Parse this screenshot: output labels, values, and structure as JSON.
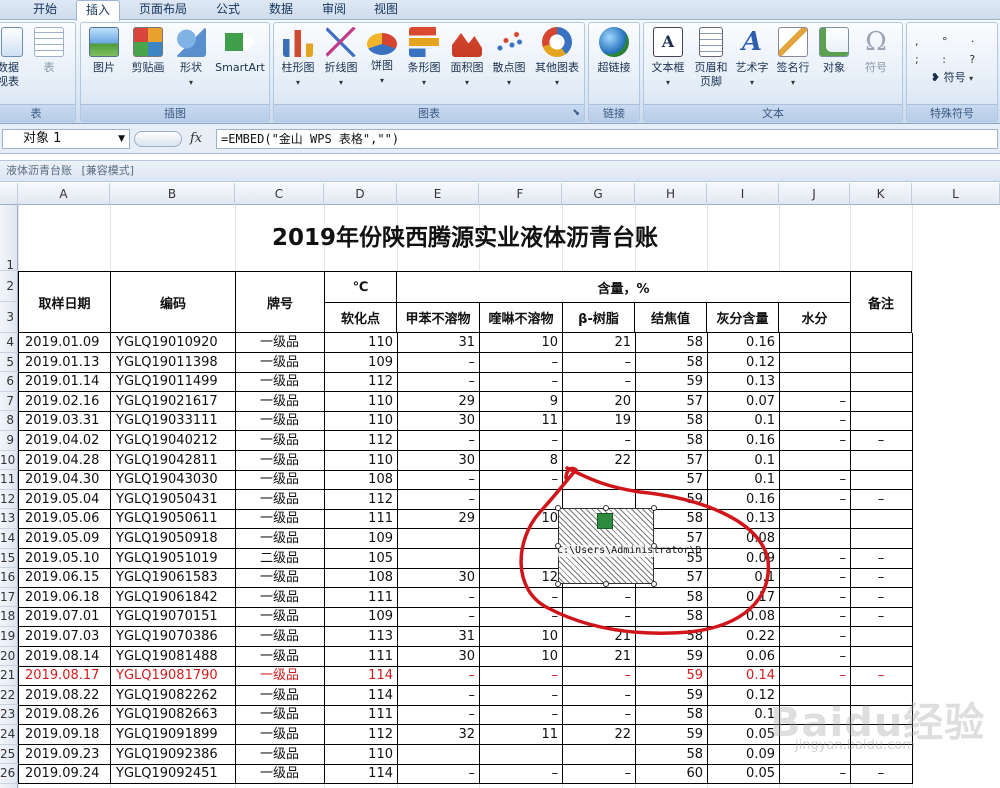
{
  "tabs": [
    "开始",
    "插入",
    "页面布局",
    "公式",
    "数据",
    "审阅",
    "视图"
  ],
  "active_tab": "插入",
  "ribbon": {
    "groups": [
      {
        "label": "表",
        "buttons": [
          {
            "label": "数据\n视表",
            "icon": "pivot-table-icon"
          },
          {
            "label": "表",
            "icon": "table-icon"
          }
        ]
      },
      {
        "label": "插图",
        "buttons": [
          {
            "label": "图片",
            "icon": "picture-icon"
          },
          {
            "label": "剪贴画",
            "icon": "clipart-icon"
          },
          {
            "label": "形状",
            "icon": "shapes-icon"
          },
          {
            "label": "SmartArt",
            "icon": "smartart-icon"
          }
        ]
      },
      {
        "label": "图表",
        "buttons": [
          {
            "label": "柱形图",
            "icon": "column-chart-icon"
          },
          {
            "label": "折线图",
            "icon": "line-chart-icon"
          },
          {
            "label": "饼图",
            "icon": "pie-chart-icon"
          },
          {
            "label": "条形图",
            "icon": "bar-chart-icon"
          },
          {
            "label": "面积图",
            "icon": "area-chart-icon"
          },
          {
            "label": "散点图",
            "icon": "scatter-chart-icon"
          },
          {
            "label": "其他图表",
            "icon": "other-charts-icon"
          }
        ]
      },
      {
        "label": "链接",
        "buttons": [
          {
            "label": "超链接",
            "icon": "hyperlink-icon"
          }
        ]
      },
      {
        "label": "文本",
        "buttons": [
          {
            "label": "文本框",
            "icon": "textbox-icon"
          },
          {
            "label": "页眉和\n页脚",
            "icon": "header-footer-icon"
          },
          {
            "label": "艺术字",
            "icon": "wordart-icon"
          },
          {
            "label": "签名行",
            "icon": "signature-icon"
          },
          {
            "label": "对象",
            "icon": "object-icon"
          },
          {
            "label": "符号",
            "icon": "symbol-icon"
          }
        ]
      },
      {
        "label": "特殊符号",
        "buttons": [
          {
            "label": "符号",
            "icon": "special-symbol-icon"
          }
        ]
      }
    ]
  },
  "formula_bar": {
    "name_box": "对象 1",
    "fx": "fx",
    "formula": "=EMBED(\"金山 WPS 表格\",\"\")"
  },
  "workbook_title": "液体沥青台账",
  "workbook_mode": "[兼容模式]",
  "columns": [
    "A",
    "B",
    "C",
    "D",
    "E",
    "F",
    "G",
    "H",
    "I",
    "J",
    "K",
    "L"
  ],
  "row_numbers": [
    "1",
    "2",
    "3",
    "4",
    "5",
    "6",
    "7",
    "8",
    "9",
    "10",
    "11",
    "12",
    "13",
    "14",
    "15",
    "16",
    "17",
    "18",
    "19",
    "20",
    "21",
    "22",
    "23",
    "24",
    "25",
    "26"
  ],
  "sheet": {
    "title": "2019年份陕西腾源实业液体沥青台账",
    "headers": {
      "date": "取样日期",
      "code": "编码",
      "grade": "牌号",
      "unit": "℃",
      "content": "含量，%",
      "remark": "备注",
      "softening": "软化点",
      "benzene": "甲苯不溶物",
      "quinoline": "喹啉不溶物",
      "beta": "β-树脂",
      "coking": "结焦值",
      "ash": "灰分含量",
      "water": "水分"
    },
    "rows": [
      [
        "2019.01.09",
        "YGLQ19010920",
        "一级品",
        "110",
        "31",
        "10",
        "21",
        "58",
        "0.16",
        "",
        ""
      ],
      [
        "2019.01.13",
        "YGLQ19011398",
        "一级品",
        "109",
        "–",
        "–",
        "–",
        "58",
        "0.12",
        "",
        ""
      ],
      [
        "2019.01.14",
        "YGLQ19011499",
        "一级品",
        "112",
        "–",
        "–",
        "–",
        "59",
        "0.13",
        "",
        ""
      ],
      [
        "2019.02.16",
        "YGLQ19021617",
        "一级品",
        "110",
        "29",
        "9",
        "20",
        "57",
        "0.07",
        "–",
        ""
      ],
      [
        "2019.03.31",
        "YGLQ19033111",
        "一级品",
        "110",
        "30",
        "11",
        "19",
        "58",
        "0.1",
        "–",
        ""
      ],
      [
        "2019.04.02",
        "YGLQ19040212",
        "一级品",
        "112",
        "–",
        "–",
        "–",
        "58",
        "0.16",
        "–",
        "–"
      ],
      [
        "2019.04.28",
        "YGLQ19042811",
        "一级品",
        "110",
        "30",
        "8",
        "22",
        "57",
        "0.1",
        "",
        ""
      ],
      [
        "2019.04.30",
        "YGLQ19043030",
        "一级品",
        "108",
        "–",
        "–",
        "",
        "57",
        "0.1",
        "–",
        ""
      ],
      [
        "2019.05.04",
        "YGLQ19050431",
        "一级品",
        "112",
        "–",
        "",
        "",
        "59",
        "0.16",
        "–",
        "–"
      ],
      [
        "2019.05.06",
        "YGLQ19050611",
        "一级品",
        "111",
        "29",
        "10",
        "",
        "58",
        "0.13",
        "",
        ""
      ],
      [
        "2019.05.09",
        "YGLQ19050918",
        "一级品",
        "109",
        "",
        "",
        "",
        "57",
        "0.08",
        "",
        ""
      ],
      [
        "2019.05.10",
        "YGLQ19051019",
        "二级品",
        "105",
        "",
        "",
        "",
        "55",
        "0.09",
        "–",
        "–"
      ],
      [
        "2019.06.15",
        "YGLQ19061583",
        "一级品",
        "108",
        "30",
        "12",
        "",
        "57",
        "0.1",
        "–",
        "–"
      ],
      [
        "2019.06.18",
        "YGLQ19061842",
        "一级品",
        "111",
        "–",
        "–",
        "–",
        "58",
        "0.17",
        "–",
        "–"
      ],
      [
        "2019.07.01",
        "YGLQ19070151",
        "一级品",
        "109",
        "–",
        "–",
        "–",
        "58",
        "0.08",
        "–",
        "–"
      ],
      [
        "2019.07.03",
        "YGLQ19070386",
        "一级品",
        "113",
        "31",
        "10",
        "21",
        "58",
        "0.22",
        "–",
        ""
      ],
      [
        "2019.08.14",
        "YGLQ19081488",
        "一级品",
        "111",
        "30",
        "10",
        "21",
        "59",
        "0.06",
        "–",
        ""
      ],
      [
        "2019.08.17",
        "YGLQ19081790",
        "一级品",
        "114",
        "–",
        "–",
        "–",
        "59",
        "0.14",
        "–",
        "–"
      ],
      [
        "2019.08.22",
        "YGLQ19082262",
        "一级品",
        "114",
        "–",
        "–",
        "–",
        "59",
        "0.12",
        "",
        ""
      ],
      [
        "2019.08.26",
        "YGLQ19082663",
        "一级品",
        "111",
        "–",
        "–",
        "–",
        "58",
        "0.1",
        "",
        ""
      ],
      [
        "2019.09.18",
        "YGLQ19091899",
        "一级品",
        "112",
        "32",
        "11",
        "22",
        "59",
        "0.05",
        "",
        ""
      ],
      [
        "2019.09.23",
        "YGLQ19092386",
        "一级品",
        "110",
        "",
        "",
        "",
        "58",
        "0.09",
        "",
        ""
      ],
      [
        "2019.09.24",
        "YGLQ19092451",
        "一级品",
        "114",
        "–",
        "–",
        "–",
        "60",
        "0.05",
        "–",
        "–"
      ]
    ],
    "highlight_row_index": 17,
    "highlight_color": "#d21c1c"
  },
  "embedded_object": {
    "label": "C:\\Users\\Administrator\\D",
    "icon": "spreadsheet-object-icon"
  },
  "annotation_color": "#d0161b",
  "watermark": {
    "text": "Baidu经验",
    "sub": "jingyan.baidu.com"
  }
}
